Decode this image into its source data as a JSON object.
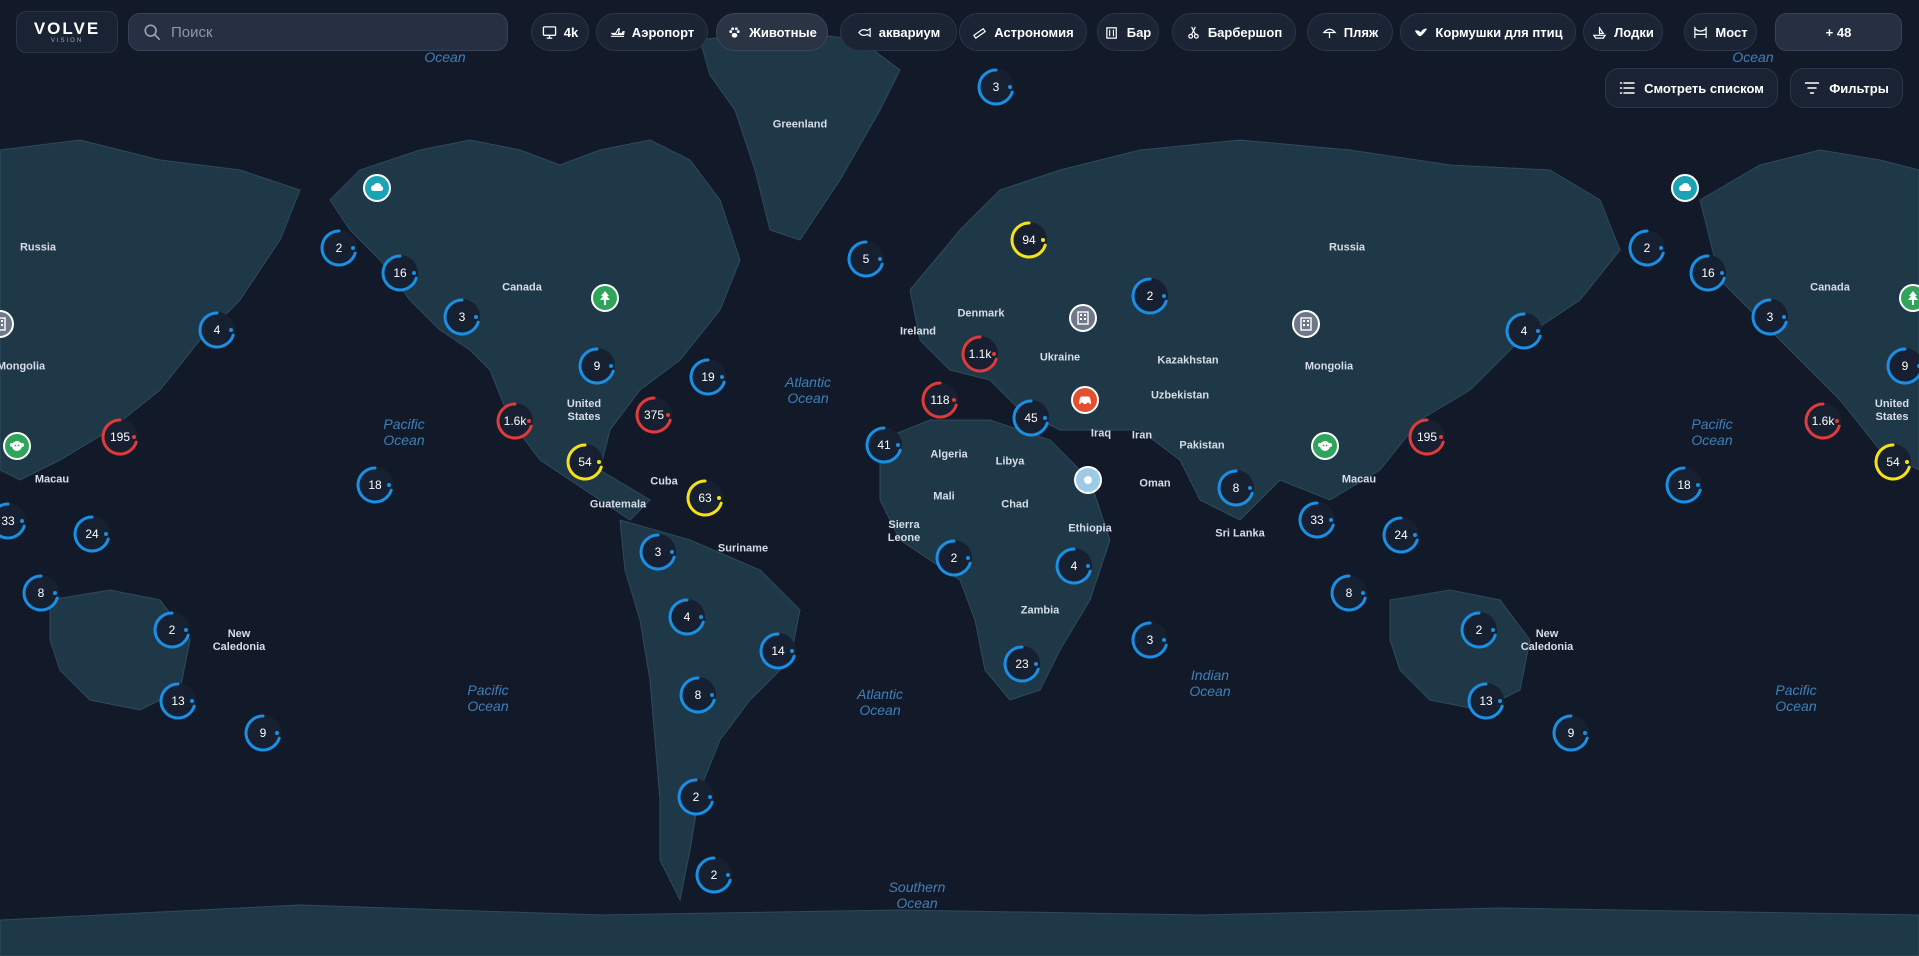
{
  "brand": {
    "name": "VOLVE",
    "tagline": "VISION"
  },
  "search": {
    "placeholder": "Поиск",
    "value": ""
  },
  "categories": [
    {
      "label": "4k",
      "icon": "monitor-icon"
    },
    {
      "label": "Аэропорт",
      "icon": "airplane-icon"
    },
    {
      "label": "Животные",
      "icon": "paw-icon",
      "active": true
    },
    {
      "label": "аквариум",
      "icon": "fish-icon"
    },
    {
      "label": "Астрономия",
      "icon": "telescope-icon"
    },
    {
      "label": "Бар",
      "icon": "bar-icon"
    },
    {
      "label": "Барбершоп",
      "icon": "scissors-icon"
    },
    {
      "label": "Пляж",
      "icon": "umbrella-icon"
    },
    {
      "label": "Кормушки для птиц",
      "icon": "bird-icon"
    },
    {
      "label": "Лодки",
      "icon": "boat-icon"
    },
    {
      "label": "Мост",
      "icon": "bridge-icon"
    }
  ],
  "more_categories": "+ 48",
  "actions": {
    "list_view": "Смотреть списком",
    "filters": "Фильтры"
  },
  "colors": {
    "background": "#121a29",
    "land": "#1f3a4c",
    "accent_blue": "#1a8fe3",
    "accent_red": "#e03a3a",
    "accent_yellow": "#f5e11a"
  },
  "map": {
    "countries": [
      "Greenland",
      "Russia",
      "Canada",
      "Denmark",
      "Ireland",
      "Ukraine",
      "Kazakhstan",
      "Mongolia",
      "Uzbekistan",
      "United States",
      "Iraq",
      "Iran",
      "Pakistan",
      "Cuba",
      "Algeria",
      "Libya",
      "Oman",
      "Macau",
      "Guatemala",
      "Mali",
      "Chad",
      "Sierra Leone",
      "Ethiopia",
      "Sri Lanka",
      "Suriname",
      "New Caledonia",
      "Zambia",
      "Russia",
      "Mongolia",
      "Macau",
      "New Caledonia",
      "Canada",
      "United States"
    ],
    "oceans": [
      "Ocean",
      "Ocean",
      "Atlantic Ocean",
      "Pacific Ocean",
      "Pacific Ocean",
      "Pacific Ocean",
      "Atlantic Ocean",
      "Indian Ocean",
      "Pacific Ocean",
      "Southern Ocean"
    ],
    "clusters": [
      {
        "count": "3",
        "status": "blue"
      },
      {
        "count": "5",
        "status": "blue"
      },
      {
        "count": "94",
        "status": "yellow"
      },
      {
        "count": "2",
        "status": "blue"
      },
      {
        "count": "16",
        "status": "blue"
      },
      {
        "count": "4",
        "status": "blue"
      },
      {
        "count": "3",
        "status": "blue"
      },
      {
        "count": "9",
        "status": "blue"
      },
      {
        "count": "19",
        "status": "blue"
      },
      {
        "count": "1.6k",
        "status": "red"
      },
      {
        "count": "375",
        "status": "red"
      },
      {
        "count": "54",
        "status": "yellow"
      },
      {
        "count": "195",
        "status": "red"
      },
      {
        "count": "18",
        "status": "blue"
      },
      {
        "count": "63",
        "status": "yellow"
      },
      {
        "count": "33",
        "status": "blue"
      },
      {
        "count": "24",
        "status": "blue"
      },
      {
        "count": "8",
        "status": "blue"
      },
      {
        "count": "3",
        "status": "blue"
      },
      {
        "count": "4",
        "status": "blue"
      },
      {
        "count": "14",
        "status": "blue"
      },
      {
        "count": "8",
        "status": "blue"
      },
      {
        "count": "2",
        "status": "blue"
      },
      {
        "count": "2",
        "status": "blue"
      },
      {
        "count": "2",
        "status": "blue"
      },
      {
        "count": "13",
        "status": "blue"
      },
      {
        "count": "9",
        "status": "blue"
      },
      {
        "count": "1.1k",
        "status": "red"
      },
      {
        "count": "118",
        "status": "red"
      },
      {
        "count": "45",
        "status": "blue"
      },
      {
        "count": "41",
        "status": "blue"
      },
      {
        "count": "2",
        "status": "blue"
      },
      {
        "count": "4",
        "status": "blue"
      },
      {
        "count": "23",
        "status": "blue"
      },
      {
        "count": "3",
        "status": "blue"
      },
      {
        "count": "2",
        "status": "blue"
      },
      {
        "count": "8",
        "status": "blue"
      },
      {
        "count": "4",
        "status": "blue"
      },
      {
        "count": "195",
        "status": "red"
      },
      {
        "count": "33",
        "status": "blue"
      },
      {
        "count": "24",
        "status": "blue"
      },
      {
        "count": "8",
        "status": "blue"
      },
      {
        "count": "2",
        "status": "blue"
      },
      {
        "count": "13",
        "status": "blue"
      },
      {
        "count": "9",
        "status": "blue"
      },
      {
        "count": "2",
        "status": "blue"
      },
      {
        "count": "16",
        "status": "blue"
      },
      {
        "count": "3",
        "status": "blue"
      },
      {
        "count": "9",
        "status": "blue"
      },
      {
        "count": "1.6k",
        "status": "red"
      },
      {
        "count": "18",
        "status": "blue"
      },
      {
        "count": "54",
        "status": "yellow"
      }
    ],
    "pins": [
      {
        "icon": "cloud-icon",
        "color": "#1aa3b5"
      },
      {
        "icon": "tree-icon",
        "color": "#2ea55a"
      },
      {
        "icon": "building-icon",
        "color": "#6e7888"
      },
      {
        "icon": "car-icon",
        "color": "#e3502e"
      },
      {
        "icon": "dot-icon",
        "color": "#9ccbe8"
      },
      {
        "icon": "building-icon",
        "color": "#6e7888"
      },
      {
        "icon": "monkey-icon",
        "color": "#2ea55a"
      },
      {
        "icon": "cloud-icon",
        "color": "#1aa3b5"
      },
      {
        "icon": "tree-icon",
        "color": "#2ea55a"
      },
      {
        "icon": "building-icon",
        "color": "#6e7888"
      },
      {
        "icon": "monkey-icon",
        "color": "#2ea55a"
      }
    ]
  }
}
